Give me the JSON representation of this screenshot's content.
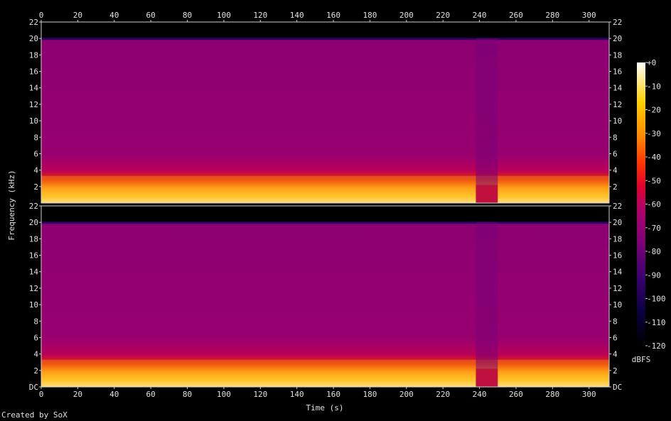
{
  "chart_data": {
    "type": "heatmap",
    "xlabel": "Time (s)",
    "ylabel": "Frequency (kHz)",
    "x_ticks": [
      0,
      20,
      40,
      60,
      80,
      100,
      120,
      140,
      160,
      180,
      200,
      220,
      240,
      260,
      280,
      300
    ],
    "xlim": [
      0,
      311
    ],
    "y_ticks_channel1": [
      "2",
      "4",
      "6",
      "8",
      "10",
      "12",
      "14",
      "16",
      "18",
      "20",
      "22"
    ],
    "y_ticks_channel2": [
      "DC",
      "2",
      "4",
      "6",
      "8",
      "10",
      "12",
      "14",
      "16",
      "18",
      "20",
      "22"
    ],
    "ylim_khz": [
      0,
      22
    ],
    "channels": 2,
    "colorbar": {
      "label": "dBFS",
      "ticks": [
        "+0",
        "-10",
        "-20",
        "-30",
        "-40",
        "-50",
        "-60",
        "-70",
        "-80",
        "-90",
        "-100",
        "-110",
        "-120"
      ],
      "range": [
        -120,
        0
      ]
    },
    "features": {
      "energy_band_khz": [
        0,
        3.3
      ],
      "cutoff_khz": 20,
      "quiet_section_s": [
        238,
        250
      ]
    }
  },
  "footer": {
    "credit": "Created by SoX"
  }
}
